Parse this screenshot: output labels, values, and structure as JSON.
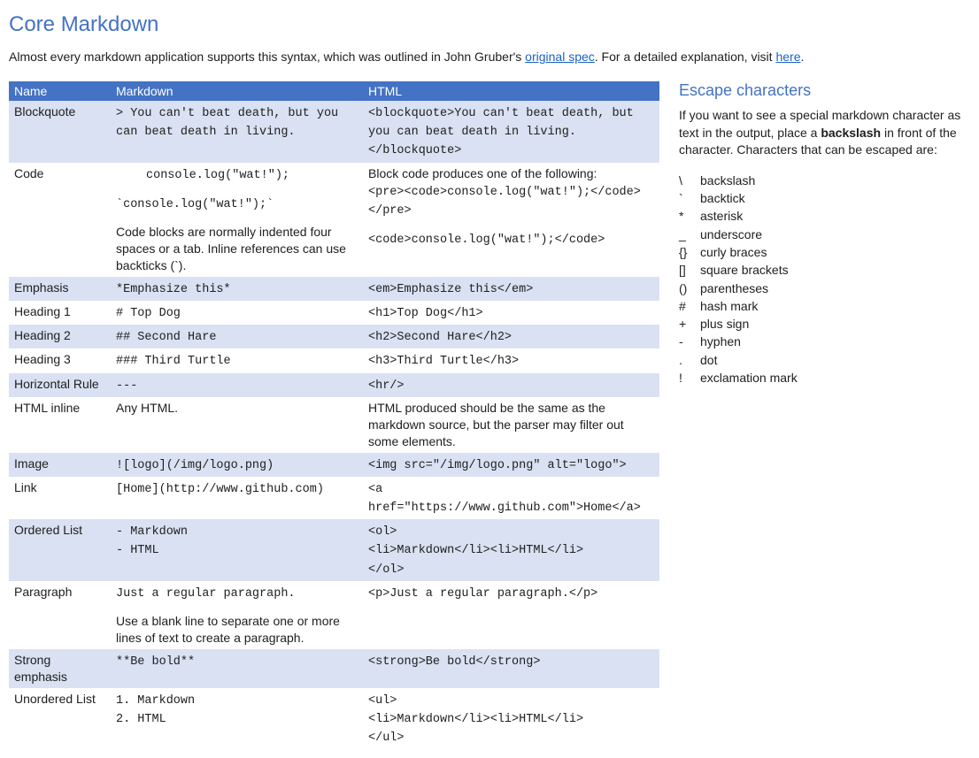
{
  "title": "Core Markdown",
  "intro": {
    "text1": "Almost every markdown application supports this syntax, which was outlined in John Gruber's ",
    "link1": "original spec",
    "text2": ". For a detailed explanation, visit ",
    "link2": "here",
    "text3": "."
  },
  "headers": {
    "name": "Name",
    "markdown": "Markdown",
    "html": "HTML"
  },
  "rows": [
    {
      "name": "Blockquote",
      "md": "> You can't beat death, but you can beat death in living.",
      "html": "<blockquote>You can't beat death, but you can beat death in living.</blockquote>",
      "mdMono": true,
      "htmlMono": true
    },
    {
      "name": "Code",
      "md_line1": "console.log(\"wat!\");",
      "md_line2": "`console.log(\"wat!\");`",
      "md_note": "Code blocks are normally indented four spaces or a tab. Inline references can use backticks (`).",
      "html_intro": "Block code produces one of the following:",
      "html_block": "<pre><code>console.log(\"wat!\");</code></pre>",
      "html_inline": "<code>console.log(\"wat!\");</code>"
    },
    {
      "name": "Emphasis",
      "md": "*Emphasize this*",
      "html": "<em>Emphasize this</em>",
      "mdMono": true,
      "htmlMono": true
    },
    {
      "name": "Heading 1",
      "md": "# Top Dog",
      "html": "<h1>Top Dog</h1>",
      "mdMono": true,
      "htmlMono": true
    },
    {
      "name": "Heading 2",
      "md": "## Second Hare",
      "html": "<h2>Second Hare</h2>",
      "mdMono": true,
      "htmlMono": true
    },
    {
      "name": "Heading 3",
      "md": "### Third Turtle",
      "html": "<h3>Third Turtle</h3>",
      "mdMono": true,
      "htmlMono": true
    },
    {
      "name": "Horizontal Rule",
      "md": "---",
      "html": "<hr/>",
      "mdMono": true,
      "htmlMono": true
    },
    {
      "name": "HTML inline",
      "md": "Any HTML.",
      "html": "HTML produced should be the same as the markdown source, but the parser may filter out some elements.",
      "mdMono": false,
      "htmlMono": false
    },
    {
      "name": "Image",
      "md": "![logo](/img/logo.png)",
      "html": "<img src=\"/img/logo.png\" alt=\"logo\">",
      "mdMono": true,
      "htmlMono": true
    },
    {
      "name": "Link",
      "md": "[Home](http://www.github.com)",
      "html": "<a href=\"https://www.github.com\">Home</a>",
      "mdMono": true,
      "htmlMono": true
    },
    {
      "name": "Ordered List",
      "md_line1": "- Markdown",
      "md_line2": "- HTML",
      "html_l1": "<ol>",
      "html_l2": "<li>Markdown</li><li>HTML</li>",
      "html_l3": "</ol>"
    },
    {
      "name": "Paragraph",
      "md_line1": "Just a regular paragraph.",
      "md_note": "Use a blank line to separate one or more lines of text to create a paragraph.",
      "html": "<p>Just a regular paragraph.</p>",
      "htmlMono": true
    },
    {
      "name": "Strong emphasis",
      "md": "**Be bold**",
      "html": "<strong>Be bold</strong>",
      "mdMono": true,
      "htmlMono": true
    },
    {
      "name": "Unordered List",
      "md_line1": "1. Markdown",
      "md_line2": "2. HTML",
      "html_l1": "<ul>",
      "html_l2": "<li>Markdown</li><li>HTML</li>",
      "html_l3": "</ul>"
    }
  ],
  "sidebar": {
    "heading": "Escape characters",
    "p1": "If you want to see a special markdown character as text in the output, place a ",
    "p_bold": "backslash",
    "p2": " in front of the character. Characters that can be escaped are:",
    "items": [
      {
        "sym": "\\",
        "label": "backslash"
      },
      {
        "sym": "`",
        "label": "backtick"
      },
      {
        "sym": "*",
        "label": "asterisk"
      },
      {
        "sym": "_",
        "label": "underscore"
      },
      {
        "sym": "{}",
        "label": "curly braces"
      },
      {
        "sym": "[]",
        "label": "square brackets"
      },
      {
        "sym": "()",
        "label": "parentheses"
      },
      {
        "sym": "#",
        "label": "hash mark"
      },
      {
        "sym": "+",
        "label": "plus sign"
      },
      {
        "sym": "-",
        "label": "hyphen"
      },
      {
        "sym": ".",
        "label": "dot"
      },
      {
        "sym": "!",
        "label": "exclamation mark"
      }
    ]
  }
}
